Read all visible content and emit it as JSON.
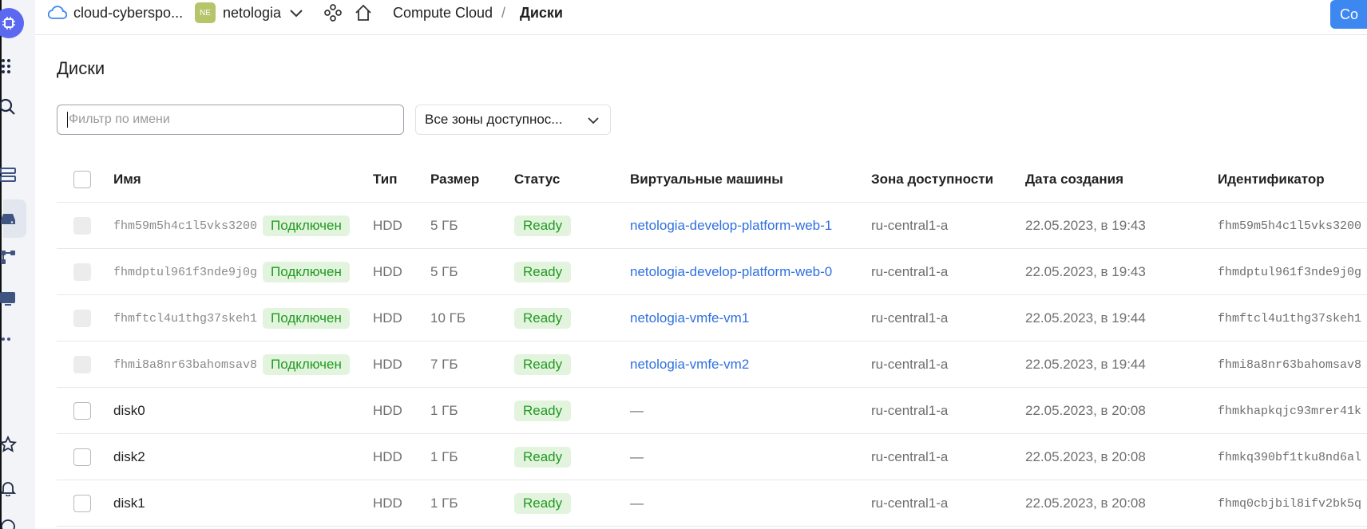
{
  "breadcrumbs": {
    "cloud": "cloud-cyberspo...",
    "org_badge": "NE",
    "org": "netologia",
    "service": "Compute Cloud",
    "separator": "/",
    "current": "Диски"
  },
  "create_button": "Со",
  "page_title": "Диски",
  "filter": {
    "placeholder": "Фильтр по имени"
  },
  "zone_select": {
    "value": "Все зоны доступнос..."
  },
  "columns": {
    "name": "Имя",
    "type": "Тип",
    "size": "Размер",
    "status": "Статус",
    "vms": "Виртуальные машины",
    "zone": "Зона доступности",
    "created": "Дата создания",
    "id": "Идентификатор"
  },
  "rows": [
    {
      "name": "fhm59m5h4c1l5vks3200",
      "attached": "Подключен",
      "type": "HDD",
      "size": "5 ГБ",
      "status": "Ready",
      "vm": "netologia-develop-platform-web-1",
      "zone": "ru-central1-a",
      "created": "22.05.2023, в 19:43",
      "id": "fhm59m5h4c1l5vks3200"
    },
    {
      "name": "fhmdptul961f3nde9j0g",
      "attached": "Подключен",
      "type": "HDD",
      "size": "5 ГБ",
      "status": "Ready",
      "vm": "netologia-develop-platform-web-0",
      "zone": "ru-central1-a",
      "created": "22.05.2023, в 19:43",
      "id": "fhmdptul961f3nde9j0g"
    },
    {
      "name": "fhmftcl4u1thg37skeh1",
      "attached": "Подключен",
      "type": "HDD",
      "size": "10 ГБ",
      "status": "Ready",
      "vm": "netologia-vmfe-vm1",
      "zone": "ru-central1-a",
      "created": "22.05.2023, в 19:44",
      "id": "fhmftcl4u1thg37skeh1"
    },
    {
      "name": "fhmi8a8nr63bahomsav8",
      "attached": "Подключен",
      "type": "HDD",
      "size": "7 ГБ",
      "status": "Ready",
      "vm": "netologia-vmfe-vm2",
      "zone": "ru-central1-a",
      "created": "22.05.2023, в 19:44",
      "id": "fhmi8a8nr63bahomsav8"
    },
    {
      "name": "disk0",
      "attached": "",
      "type": "HDD",
      "size": "1 ГБ",
      "status": "Ready",
      "vm": "—",
      "zone": "ru-central1-a",
      "created": "22.05.2023, в 20:08",
      "id": "fhmkhapkqjc93mrer41k"
    },
    {
      "name": "disk2",
      "attached": "",
      "type": "HDD",
      "size": "1 ГБ",
      "status": "Ready",
      "vm": "—",
      "zone": "ru-central1-a",
      "created": "22.05.2023, в 20:08",
      "id": "fhmkq390bf1tku8nd6al"
    },
    {
      "name": "disk1",
      "attached": "",
      "type": "HDD",
      "size": "1 ГБ",
      "status": "Ready",
      "vm": "—",
      "zone": "ru-central1-a",
      "created": "22.05.2023, в 20:08",
      "id": "fhmq0cbjbil8ifv2bk5q"
    }
  ],
  "colors": {
    "accent": "#3c87f0",
    "link": "#2f6fe0",
    "ready_text": "#1f9a1f",
    "ready_bg": "#e3f4de",
    "org_badge": "#b7c56a"
  }
}
